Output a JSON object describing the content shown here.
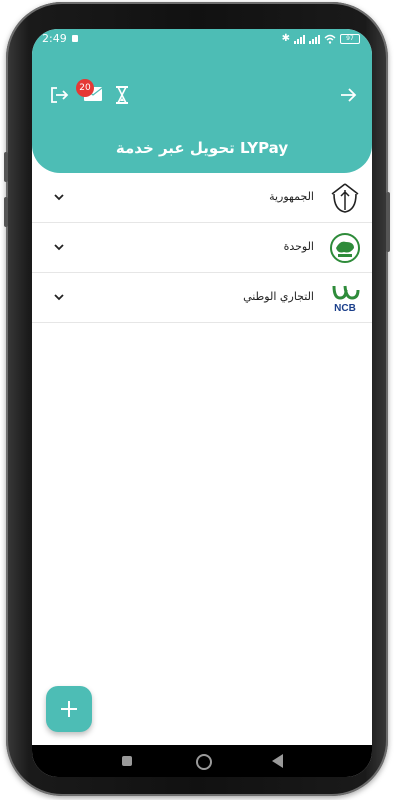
{
  "status_bar": {
    "time": "2:49",
    "battery": "97"
  },
  "header": {
    "title": "تحويل عبر خدمة LYPay",
    "notification_count": "20"
  },
  "banks": [
    {
      "name": "الجمهورية",
      "logo": "jumhouria-logo"
    },
    {
      "name": "الوحدة",
      "logo": "wahda-logo"
    },
    {
      "name": "التجاري الوطني",
      "logo": "ncb-logo",
      "logo_text": "NCB"
    }
  ],
  "colors": {
    "accent": "#4dbdb5",
    "badge": "#e53935",
    "ncb_green": "#2e8b3a"
  }
}
